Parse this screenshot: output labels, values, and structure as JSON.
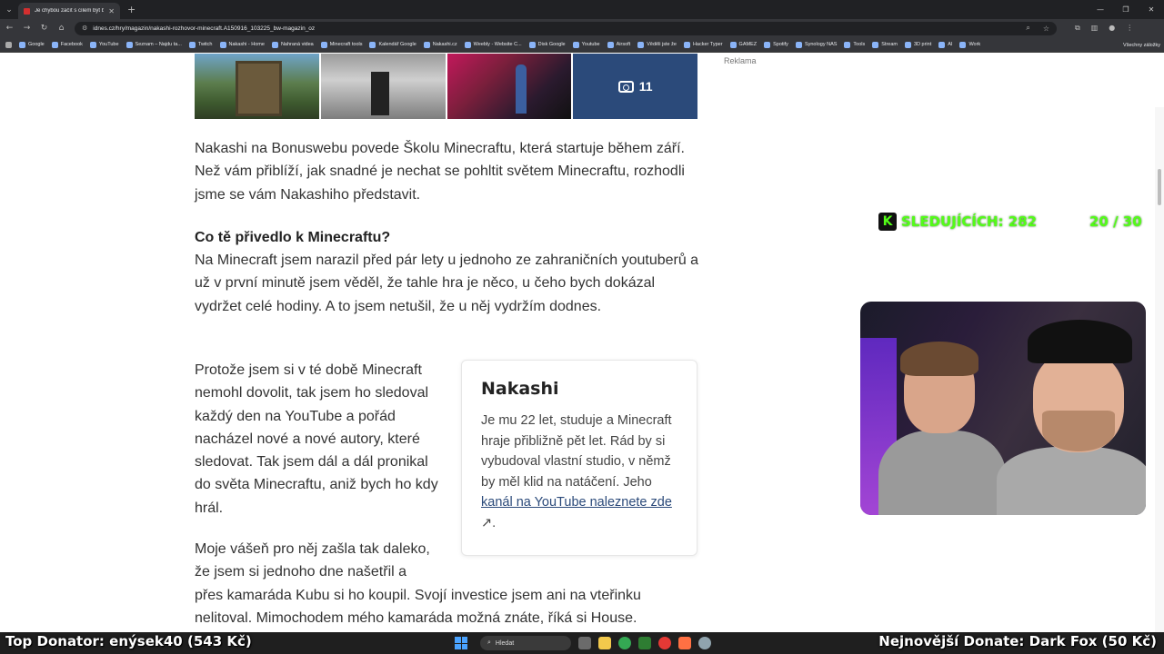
{
  "browser": {
    "tab_title": "Je chybou začít s cílem být bohatý...",
    "url": "idnes.cz/hry/magazin/nakashi-rozhovor-minecraft.A150916_103225_bw-magazin_oz",
    "bookmarks": [
      "Google",
      "Facebook",
      "YouTube",
      "Seznam – Najdu ta...",
      "Twitch",
      "Nakashi - Home",
      "Nahraná videa",
      "Minecraft tools",
      "Kalendář Google",
      "Nakashi.cz",
      "Weebly - Website C...",
      "Disk Google",
      "Youtube",
      "Airsoft",
      "Věděli jste že",
      "Hacker Typer",
      "GAMEZ",
      "Spotify",
      "Synology NAS",
      "Tools",
      "Stream",
      "3D print",
      "AI",
      "Work"
    ],
    "all_bookmarks": "Všechny záložky"
  },
  "page": {
    "ad_label": "Reklama",
    "gallery_count": "11",
    "p1": "Nakashi na Bonuswebu povede Školu Minecraftu, která startuje během září. Než vám přiblíží, jak snadné je nechat se pohltit světem Minecraftu, rozhodli jsme se vám Nakashiho představit.",
    "heading": "Co tě přivedlo k Minecraftu?",
    "p2": "Na Minecraft jsem narazil před pár lety u jednoho ze zahraničních youtuberů a už v první minutě jsem věděl, že tahle hra je něco, u čeho bych dokázal vydržet celé hodiny. A to jsem netušil, že u něj vydržím dodnes.",
    "p3": "Protože jsem si v té době Minecraft nemohl dovolit, tak jsem ho sledoval každý den na YouTube a pořád nacházel nové a nové autory, které sledovat. Tak jsem dál a dál pronikal do světa Minecraftu, aniž bych ho kdy hrál.",
    "p4a": "Moje vášeň pro něj zašla tak daleko, že jsem si jednoho dne našetřil a",
    "p4b": "přes kamaráda Kubu si ho koupil. Svojí investice jsem ani na vteřinku nelitoval. Mimochodem mého kamaráda možná znáte, říká si House.",
    "box_title": "Nakashi",
    "box_text": "Je mu 22 let, studuje a Minecraft hraje přibližně pět let. Rád by si vybudoval vlastní studio, v němž by měl klid na natáčení. Jeho ",
    "box_link": "kanál na YouTube naleznete zde",
    "box_end": "."
  },
  "overlay": {
    "followers": "SLEDUJÍCÍCH: 282",
    "goal": "20 / 30",
    "top_donor": "Top Donator: enýsek40  (543 Kč)",
    "latest_donor": "Nejnovější Donate: Dark Fox (50 Kč)"
  },
  "taskbar": {
    "search": "Hledat"
  },
  "colors": {
    "kick_green": "#53fc18",
    "link": "#2b4a7a"
  }
}
